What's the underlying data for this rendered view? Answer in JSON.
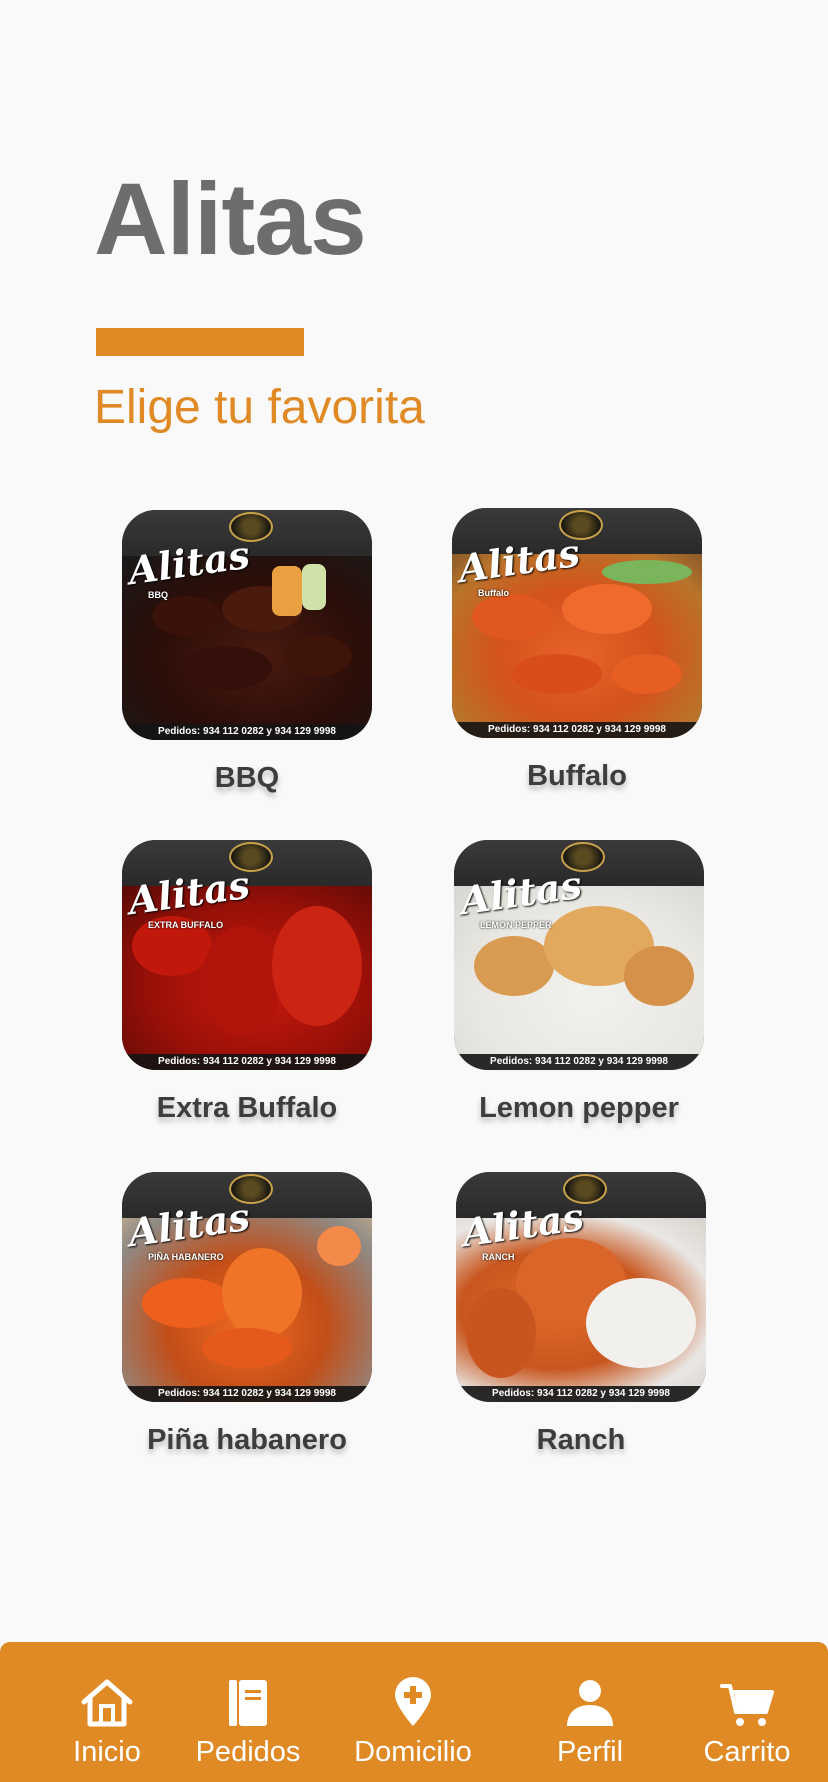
{
  "header": {
    "title": "Alitas",
    "subtitle": "Elige tu favorita"
  },
  "colors": {
    "accent": "#e08a25",
    "title_gray": "#6d6d6d",
    "background": "#f9f9f9"
  },
  "menu": {
    "items": [
      {
        "label": "BBQ",
        "image_text": {
          "brand": "Alitas",
          "tag": "BBQ",
          "footer": "Pedidos: 934 112 0282 y 934 129 9998"
        }
      },
      {
        "label": "Buffalo",
        "image_text": {
          "brand": "Alitas",
          "tag": "Buffalo",
          "footer": "Pedidos: 934 112 0282 y 934 129 9998"
        }
      },
      {
        "label": "Extra Buffalo",
        "image_text": {
          "brand": "Alitas",
          "tag": "EXTRA BUFFALO",
          "footer": "Pedidos: 934 112 0282 y 934 129 9998"
        }
      },
      {
        "label": "Lemon pepper",
        "image_text": {
          "brand": "Alitas",
          "tag": "LEMON PEPPER",
          "footer": "Pedidos: 934 112 0282 y 934 129 9998"
        }
      },
      {
        "label": "Piña habanero",
        "image_text": {
          "brand": "Alitas",
          "tag": "PIÑA HABANERO",
          "footer": "Pedidos: 934 112 0282 y 934 129 9998"
        }
      },
      {
        "label": "Ranch",
        "image_text": {
          "brand": "Alitas",
          "tag": "RANCH",
          "footer": "Pedidos: 934 112 0282 y 934 129 9998"
        }
      }
    ]
  },
  "nav": {
    "items": [
      {
        "label": "Inicio",
        "icon": "home-icon"
      },
      {
        "label": "Pedidos",
        "icon": "book-icon"
      },
      {
        "label": "Domicilio",
        "icon": "location-plus-icon"
      },
      {
        "label": "Perfil",
        "icon": "user-icon"
      },
      {
        "label": "Carrito",
        "icon": "cart-icon"
      }
    ]
  }
}
